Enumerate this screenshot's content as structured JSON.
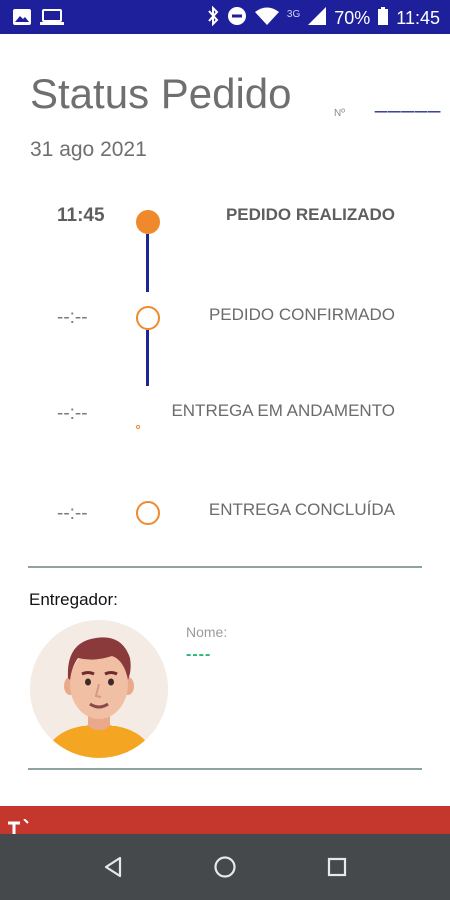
{
  "status_bar": {
    "battery": "70%",
    "network": "3G",
    "time": "11:45"
  },
  "header": {
    "title": "Status Pedido",
    "number_label": "Nº",
    "number_value": "_____",
    "date": "31 ago 2021"
  },
  "timeline": [
    {
      "time": "11:45",
      "label": "PEDIDO REALIZADO",
      "state": "done"
    },
    {
      "time": "--:--",
      "label": "PEDIDO CONFIRMADO",
      "state": "pending"
    },
    {
      "time": "--:--",
      "label": "ENTREGA EM ANDAMENTO",
      "state": "pending"
    },
    {
      "time": "--:--",
      "label": "ENTREGA CONCLUÍDA",
      "state": "pending"
    }
  ],
  "courier": {
    "section_title": "Entregador:",
    "name_label": "Nome:",
    "name_value": "----"
  },
  "colors": {
    "accent": "#f0892c",
    "timeline_line": "#1c2796",
    "status_bar": "#1e1f9a",
    "red_bar": "#c5372c",
    "name_value": "#2bb673"
  },
  "nav": {
    "icons": [
      "back-icon",
      "home-icon",
      "recents-icon"
    ]
  }
}
